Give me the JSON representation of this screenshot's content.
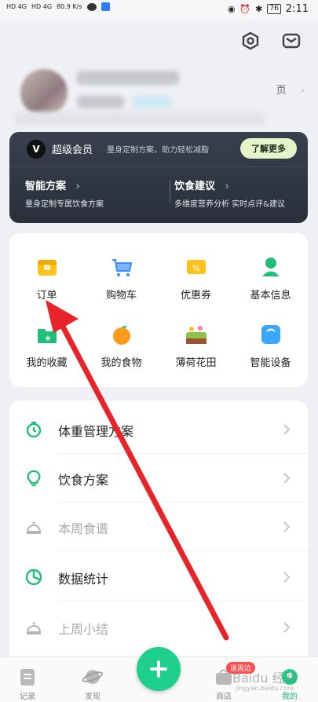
{
  "status_bar": {
    "left": [
      "HD 4G",
      "HD 4G",
      "80.9 K/s"
    ],
    "battery": "76",
    "time": "2:11"
  },
  "profile": {
    "home_link": "页"
  },
  "vip": {
    "logo": "V",
    "title": "超级会员",
    "subtitle": "量身定制方案，助力轻松减脂",
    "button": "了解更多",
    "left": {
      "title": "智能方案",
      "desc": "量身定制专属饮食方案"
    },
    "right": {
      "title": "饮食建议",
      "desc": "多维度营养分析 实时点评&建议"
    }
  },
  "grid": {
    "items": [
      {
        "label": "订单",
        "icon": "order-box-icon",
        "color": "#f5b400"
      },
      {
        "label": "购物车",
        "icon": "shopping-cart-icon",
        "color": "#3d8bff"
      },
      {
        "label": "优惠券",
        "icon": "coupon-icon",
        "color": "#ffc21a"
      },
      {
        "label": "基本信息",
        "icon": "user-icon",
        "color": "#21c07a"
      },
      {
        "label": "我的收藏",
        "icon": "favorites-folder-icon",
        "color": "#21c07a"
      },
      {
        "label": "我的食物",
        "icon": "orange-food-icon",
        "color": "#ff8a00"
      },
      {
        "label": "薄荷花田",
        "icon": "flower-field-icon",
        "color": "#6bb64a"
      },
      {
        "label": "智能设备",
        "icon": "smart-scale-icon",
        "color": "#3aa7ff"
      }
    ]
  },
  "list": {
    "items": [
      {
        "label": "体重管理方案",
        "icon": "timer-icon",
        "active": true
      },
      {
        "label": "饮食方案",
        "icon": "lightbulb-icon",
        "active": true
      },
      {
        "label": "本周食谱",
        "icon": "dish-cover-icon",
        "active": false
      },
      {
        "label": "数据统计",
        "icon": "pie-chart-icon",
        "active": true
      },
      {
        "label": "上周小结",
        "icon": "dish-cover-icon",
        "active": false
      }
    ]
  },
  "bottom_nav": {
    "items": [
      {
        "label": "记录",
        "icon": "record-icon"
      },
      {
        "label": "发现",
        "icon": "planet-icon"
      },
      {
        "label": "商店",
        "icon": "store-icon"
      },
      {
        "label": "我的",
        "icon": "profile-icon"
      }
    ],
    "badge": "送周边",
    "watermark": "Baidu 经验",
    "watermark_sub": "jingyan.baidu.com"
  },
  "colors": {
    "accent": "#1fcf8e",
    "annotation_arrow": "#e8242b"
  }
}
